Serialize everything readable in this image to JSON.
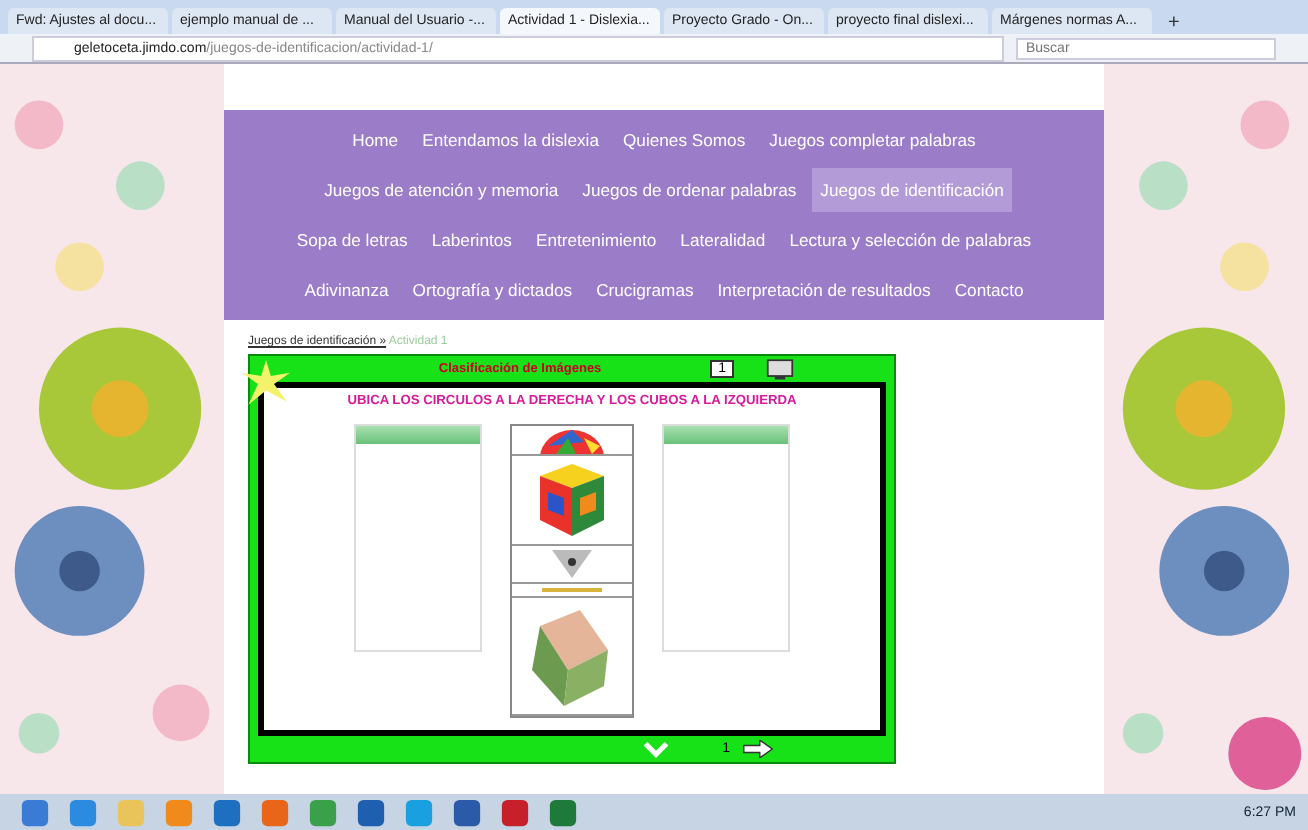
{
  "browser": {
    "tabs": [
      {
        "title": "Fwd: Ajustes al docu...",
        "selected": false
      },
      {
        "title": "ejemplo manual de ...",
        "selected": false
      },
      {
        "title": "Manual del Usuario -...",
        "selected": false
      },
      {
        "title": "Actividad 1 - Dislexia...",
        "selected": true
      },
      {
        "title": "Proyecto Grado - On...",
        "selected": false
      },
      {
        "title": "proyecto final dislexi...",
        "selected": false
      },
      {
        "title": "Márgenes normas A...",
        "selected": false
      }
    ],
    "new_tab": "+",
    "address": {
      "host": "geletoceta.jimdo.com",
      "path": "/juegos-de-identificacion/actividad-1/"
    },
    "search": {
      "placeholder": "Buscar"
    }
  },
  "nav": {
    "lines": [
      {
        "links": [
          {
            "label": "Home",
            "selected": false
          },
          {
            "label": "Entendamos la dislexia",
            "selected": false
          },
          {
            "label": "Quienes Somos",
            "selected": false
          },
          {
            "label": "Juegos completar palabras",
            "selected": false
          }
        ]
      },
      {
        "links": [
          {
            "label": "Juegos de atención y memoria",
            "selected": false
          },
          {
            "label": "Juegos de ordenar palabras",
            "selected": false
          },
          {
            "label": "Juegos de identificación",
            "selected": true
          }
        ]
      },
      {
        "links": [
          {
            "label": "Sopa de letras",
            "selected": false
          },
          {
            "label": "Laberintos",
            "selected": false
          },
          {
            "label": "Entretenimiento",
            "selected": false
          },
          {
            "label": "Lateralidad",
            "selected": false
          },
          {
            "label": "Lectura y selección de palabras",
            "selected": false
          }
        ]
      },
      {
        "links": [
          {
            "label": "Adivinanza",
            "selected": false
          },
          {
            "label": "Ortografía y dictados",
            "selected": false
          },
          {
            "label": "Crucigramas",
            "selected": false
          },
          {
            "label": "Interpretación de resultados",
            "selected": false
          },
          {
            "label": "Contacto",
            "selected": false
          }
        ]
      }
    ]
  },
  "breadcrumb": {
    "parent": "Juegos de identificación »",
    "current": "Actividad 1"
  },
  "game": {
    "title": "Clasificación de Imágenes",
    "page_number": "1",
    "instruction": "UBICA LOS CIRCULOS A LA DERECHA Y LOS CUBOS A LA IZQUIERDA",
    "items": [
      {
        "kind": "ball"
      },
      {
        "kind": "rubik"
      },
      {
        "kind": "cone"
      },
      {
        "kind": "bar"
      },
      {
        "kind": "cube"
      }
    ],
    "footer_page": "1"
  },
  "taskbar": {
    "clock": "6:27 PM"
  }
}
